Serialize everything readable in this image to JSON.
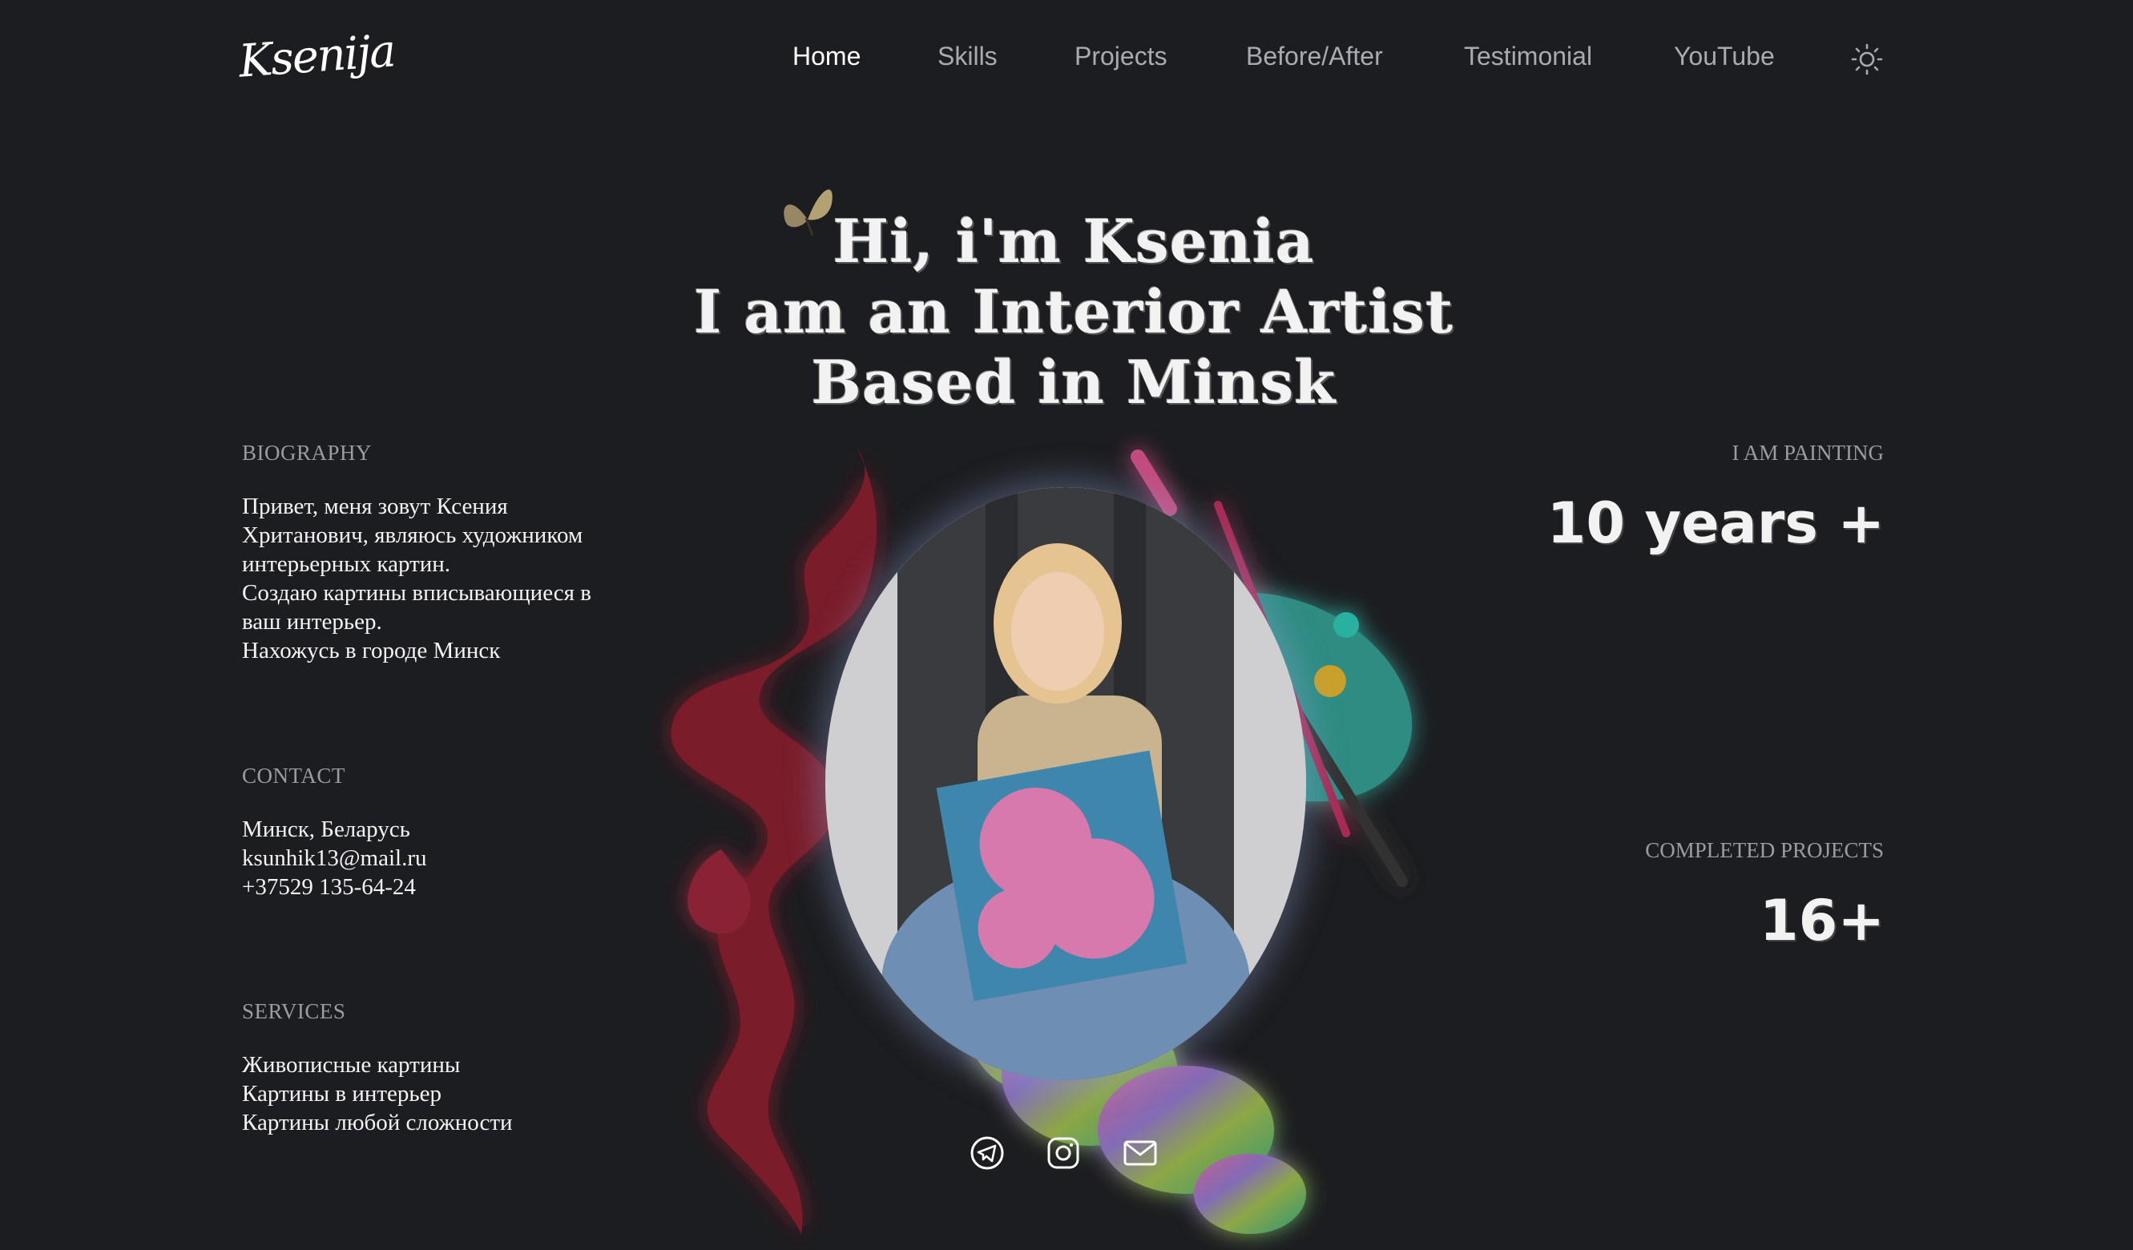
{
  "header": {
    "logo": "Ksenija",
    "nav": [
      {
        "label": "Home",
        "active": true
      },
      {
        "label": "Skills"
      },
      {
        "label": "Projects"
      },
      {
        "label": "Before/After"
      },
      {
        "label": "Testimonial"
      },
      {
        "label": "YouTube"
      }
    ],
    "theme_icon": "sun-icon"
  },
  "hero": {
    "line1": "Hi, i'm Ksenia",
    "line2": "I am an Interior Artist",
    "line3": "Based in Minsk"
  },
  "biography": {
    "label": "BIOGRAPHY",
    "lines": [
      "Привет, меня зовут Ксения",
      "Хританович, являюсь художником",
      "интерьерных картин.",
      "Создаю картины вписывающиеся в",
      "ваш интерьер.",
      "Нахожусь в городе Минск"
    ]
  },
  "contact": {
    "label": "CONTACT",
    "city": "Минск, Беларусь",
    "email": "ksunhik13@mail.ru",
    "phone": "+37529 135-64-24"
  },
  "services": {
    "label": "SERVICES",
    "items": [
      "Живописные картины",
      "Картины в интерьер",
      "Картины любой сложности"
    ]
  },
  "stats": {
    "painting_label": "I AM PAINTING",
    "painting_value": "10 years +",
    "projects_label": "COMPLETED PROJECTS",
    "projects_value": "16+"
  },
  "social": [
    "telegram-icon",
    "instagram-icon",
    "mail-icon"
  ],
  "colors": {
    "background": "#1c1d20",
    "text": "#ffffff",
    "muted": "#9a9ca1",
    "nav_inactive": "#a9abb0"
  }
}
